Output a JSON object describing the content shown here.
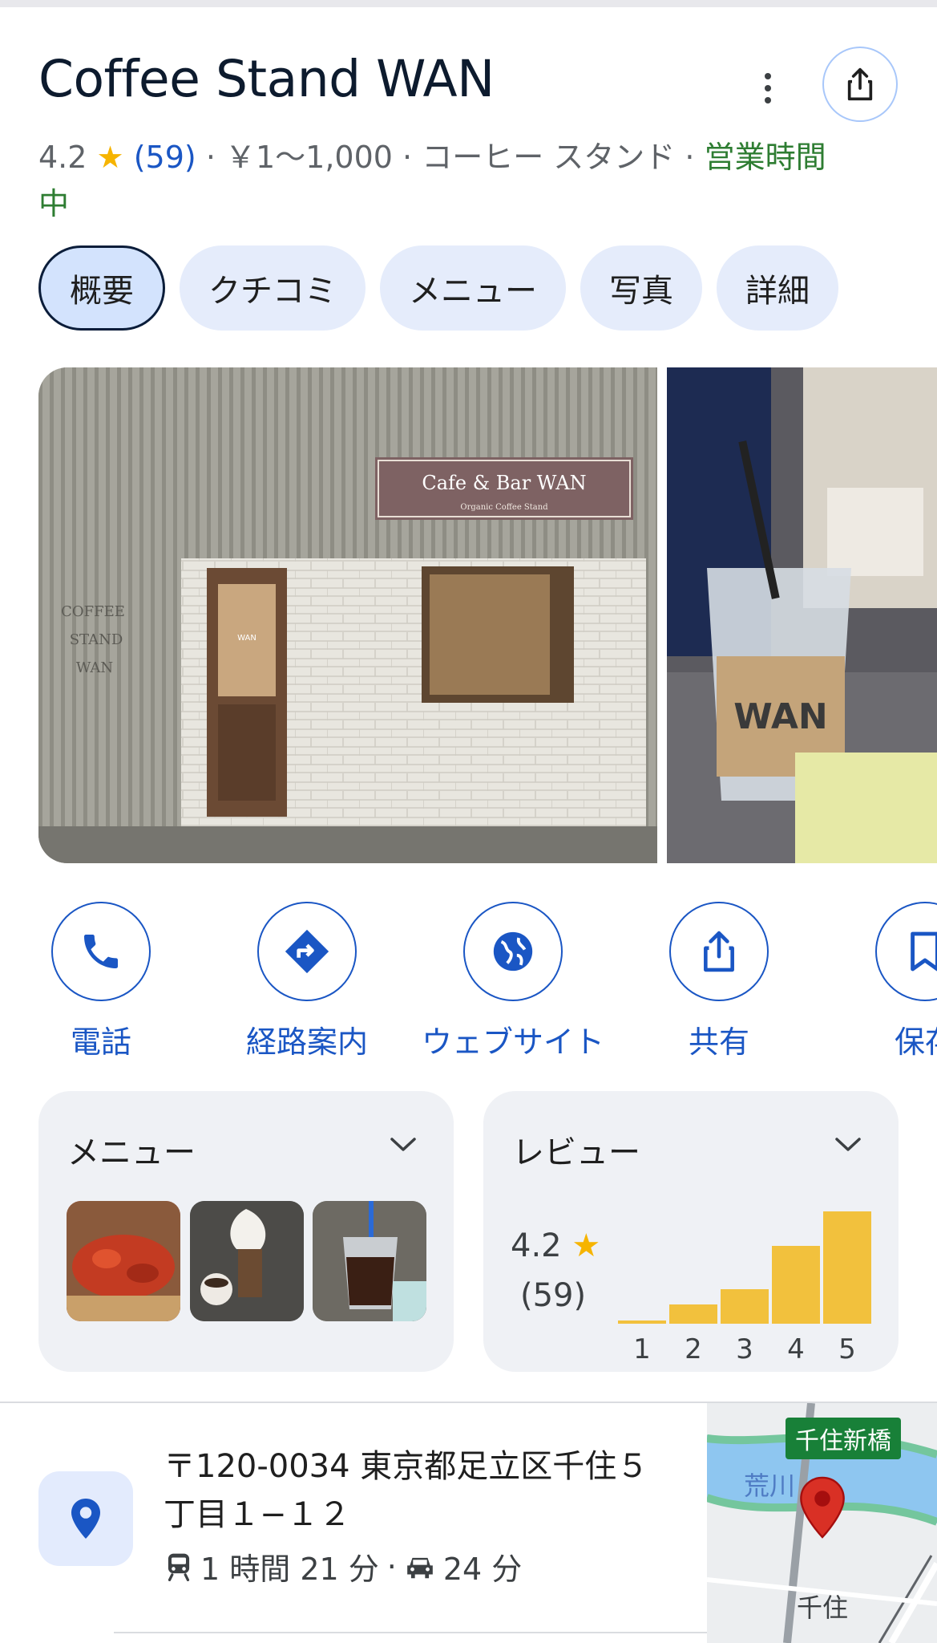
{
  "place": {
    "name": "Coffee Stand WAN",
    "rating": "4.2",
    "review_count": "(59)",
    "price": "￥1〜1,000",
    "category": "コーヒー スタンド",
    "status": "営業時間中"
  },
  "tabs": [
    {
      "label": "概要",
      "active": true
    },
    {
      "label": "クチコミ"
    },
    {
      "label": "メニュー"
    },
    {
      "label": "写真"
    },
    {
      "label": "詳細"
    }
  ],
  "photos": {
    "sign_text": "Cafe & Bar WAN",
    "sign_subtext": "Organic Coffee Stand",
    "wall_text": [
      "COFFEE",
      "STAND",
      "WAN"
    ],
    "door_text": "WAN",
    "cup_text": "WAN"
  },
  "actions": [
    {
      "label": "電話",
      "icon": "phone-icon"
    },
    {
      "label": "経路案内",
      "icon": "directions-icon"
    },
    {
      "label": "ウェブサイト",
      "icon": "globe-icon"
    },
    {
      "label": "共有",
      "icon": "share-icon"
    },
    {
      "label": "保存",
      "icon": "bookmark-icon"
    }
  ],
  "menu_card": {
    "title": "メニュー"
  },
  "review_card": {
    "title": "レビュー",
    "rating": "4.2",
    "count": "(59)",
    "distribution": [
      {
        "stars": "1",
        "share": 0.03
      },
      {
        "stars": "2",
        "share": 0.17
      },
      {
        "stars": "3",
        "share": 0.31
      },
      {
        "stars": "4",
        "share": 0.69
      },
      {
        "stars": "5",
        "share": 1.0
      }
    ]
  },
  "address": {
    "line": "〒120-0034 東京都足立区千住５丁目１−１２",
    "transit_time": "1 時間 21 分",
    "drive_time": "24 分"
  },
  "map": {
    "station_tag": "千住新橋",
    "river_label": "荒川",
    "area_label": "千住"
  },
  "colors": {
    "accent_blue": "#1a56c4",
    "open_green": "#2e7d32",
    "star_yellow": "#f6b400",
    "bar_yellow": "#f2c13d"
  }
}
